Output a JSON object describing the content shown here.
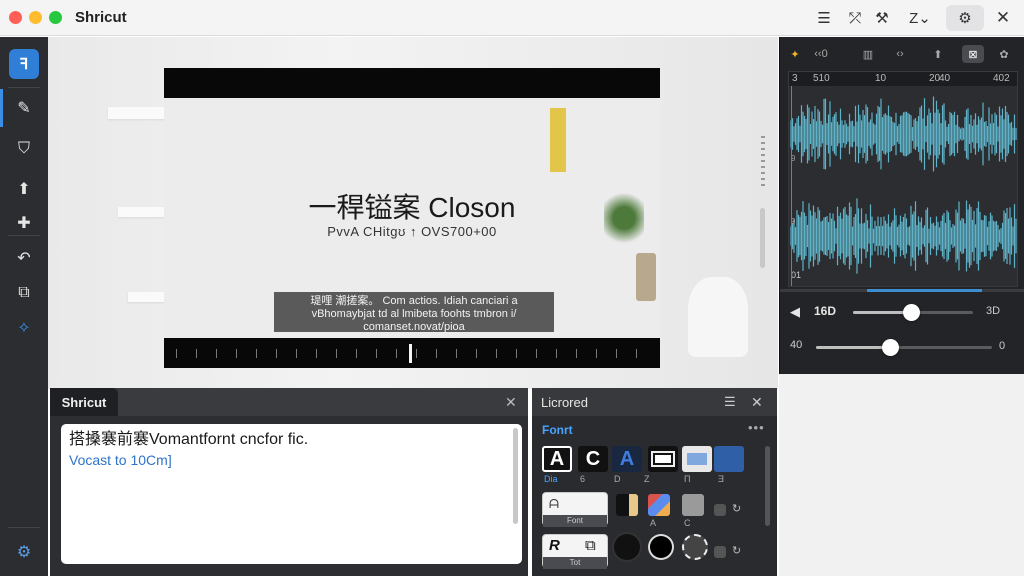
{
  "window": {
    "title": "Shricut"
  },
  "titlebar_icons": [
    "list-icon",
    "cursor-icon",
    "magic-wand-icon",
    "text-z-icon",
    "settings-icon",
    "close-icon"
  ],
  "titlebar_text": {
    "zoom_label": "Z⌄"
  },
  "sidebar": {
    "items": [
      {
        "name": "logo",
        "glyph": "ꟻ"
      },
      {
        "name": "edit-pencil",
        "glyph": "✎"
      },
      {
        "name": "subtitle",
        "glyph": "⛉"
      },
      {
        "name": "upload",
        "glyph": "⬆"
      },
      {
        "name": "plugin",
        "glyph": "✚"
      },
      {
        "name": "undo",
        "glyph": "↶"
      },
      {
        "name": "crop",
        "glyph": "⧉"
      },
      {
        "name": "magic",
        "glyph": "✧"
      },
      {
        "name": "bottom-tool",
        "glyph": "⚙"
      }
    ]
  },
  "preview": {
    "title": "一稈镒案 Closon",
    "subtitle": "PvvA CHitgʊ ↑ OVS700+00",
    "caption": "瑅哩 潮搓案。 Com actios. Idiah canciari a vBhomaybjat td al lmibeta foohts tmbron i/ comanset.novat/pioa"
  },
  "audio_panel": {
    "tabs": [
      "✦",
      "‹‹0",
      "▥",
      "‹›",
      "⬆",
      "⊠",
      "✿"
    ],
    "ruler_labels": [
      "3",
      "510",
      "10",
      "20",
      "40",
      "402"
    ],
    "channel_labels": {
      "top": "9",
      "mid": "9",
      "bottom": "01"
    },
    "volume": {
      "label": "16D",
      "end_label": "3D",
      "level": 0.48
    },
    "balance": {
      "label": "40",
      "end_label": "0",
      "level": 0.42
    },
    "wave_color": "#5fb3c8"
  },
  "editor": {
    "tab": "Shricut",
    "line1": "搭搡褰前褰Vomantfornt cncfor fic.",
    "line2": "Vocast to 10Cm]"
  },
  "style_panel": {
    "title": "Licrored",
    "section": "Fonrt",
    "swatch_labels": [
      "Dia",
      "6",
      "D",
      "Z",
      "Π",
      "Ǝ"
    ],
    "row2_labels": [
      "Font",
      "A",
      "C"
    ],
    "row3_labels": [
      "Tot"
    ],
    "card_letters": {
      "r1": [
        "A",
        "C",
        "A"
      ],
      "r3": "R"
    }
  }
}
